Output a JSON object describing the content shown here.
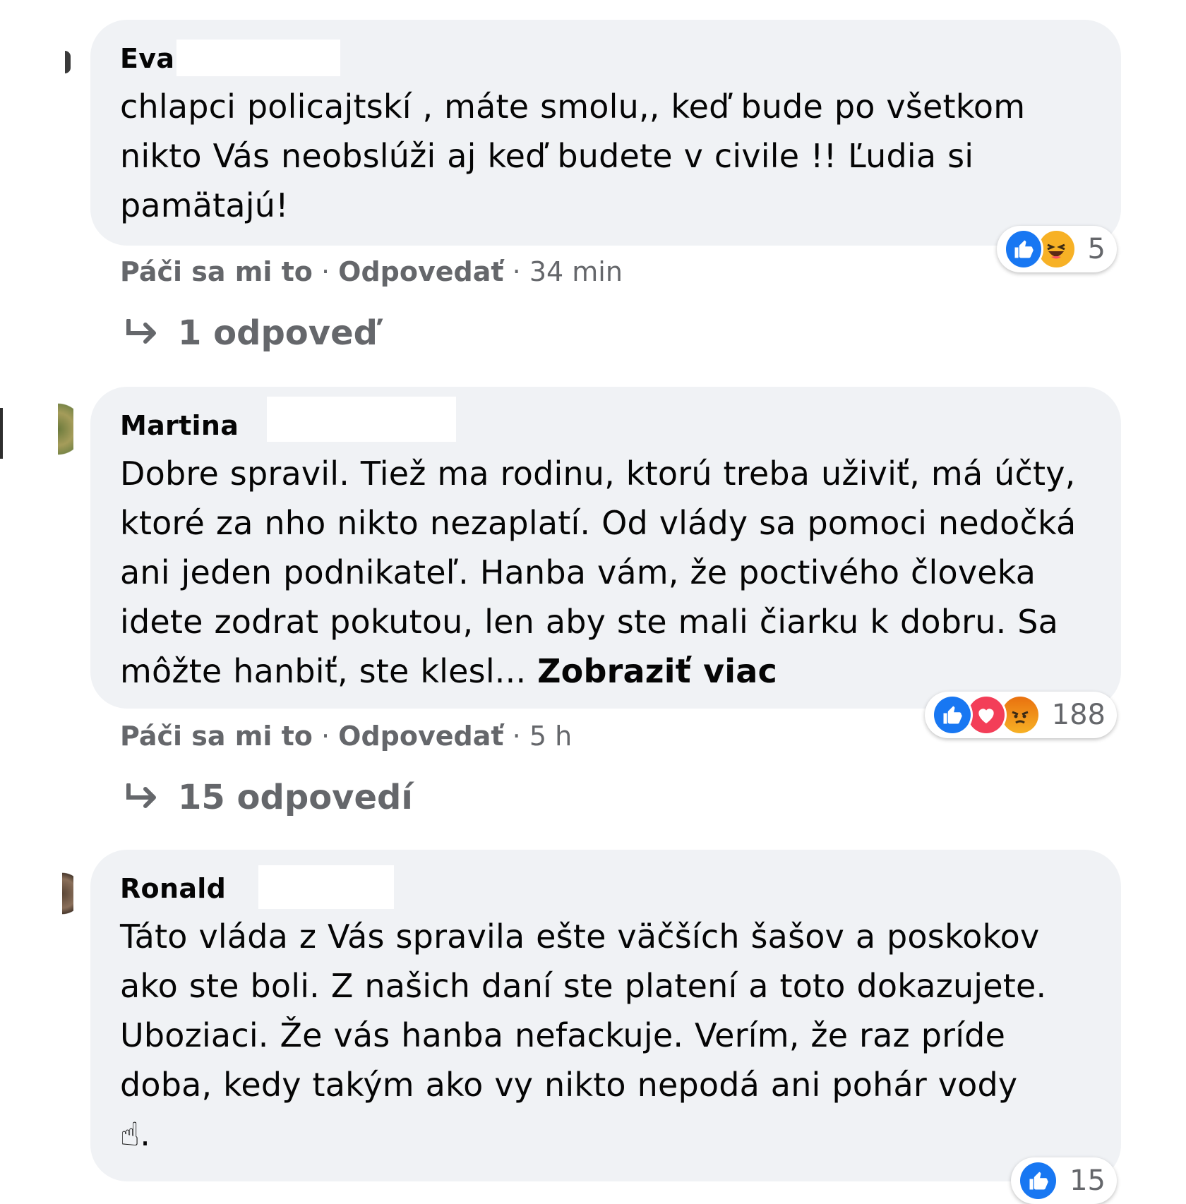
{
  "comments": [
    {
      "author": "Eva",
      "text": "chlapci policajtskí , máte smolu,, keď bude po všetkom nikto Vás neobslúži aj keď budete v civile !! Ľudia si pamätajú!",
      "see_more": "",
      "reaction_count": "5",
      "reactions": [
        "like-icon",
        "haha-icon"
      ],
      "like_label": "Páči sa mi to",
      "reply_label": "Odpovedať",
      "time": "34 min",
      "replies_label": "1 odpoveď"
    },
    {
      "author": "Martina",
      "text": "Dobre spravil. Tiež ma rodinu, ktorú treba uživiť, má účty, ktoré za nho nikto nezaplatí. Od vlády sa pomoci nedočká ani jeden podnikateľ. Hanba vám, že poctivého človeka idete zodrat pokutou, len aby ste mali čiarku k dobru. Sa môžte hanbiť, ste klesl...",
      "see_more": "Zobraziť viac",
      "reaction_count": "188",
      "reactions": [
        "like-icon",
        "love-icon",
        "angry-icon"
      ],
      "like_label": "Páči sa mi to",
      "reply_label": "Odpovedať",
      "time": "5 h",
      "replies_label": "15 odpovedí"
    },
    {
      "author": "Ronald",
      "text": "Táto vláda z Vás spravila ešte väčších šašov a poskokov ako ste boli. Z našich daní ste platení a toto dokazujete. Uboziaci. Že vás hanba nefackuje. Verím, že raz príde doba, kedy takým ako vy nikto nepodá ani pohár vody",
      "text_end": "☝.",
      "see_more": "",
      "reaction_count": "15",
      "reactions": [
        "like-icon"
      ]
    }
  ],
  "separator": "·",
  "colors": {
    "bubble": "#f0f2f5",
    "meta": "#65676b",
    "like": "#1877f2",
    "love": "#f33e58",
    "haha": "#f7b125"
  }
}
